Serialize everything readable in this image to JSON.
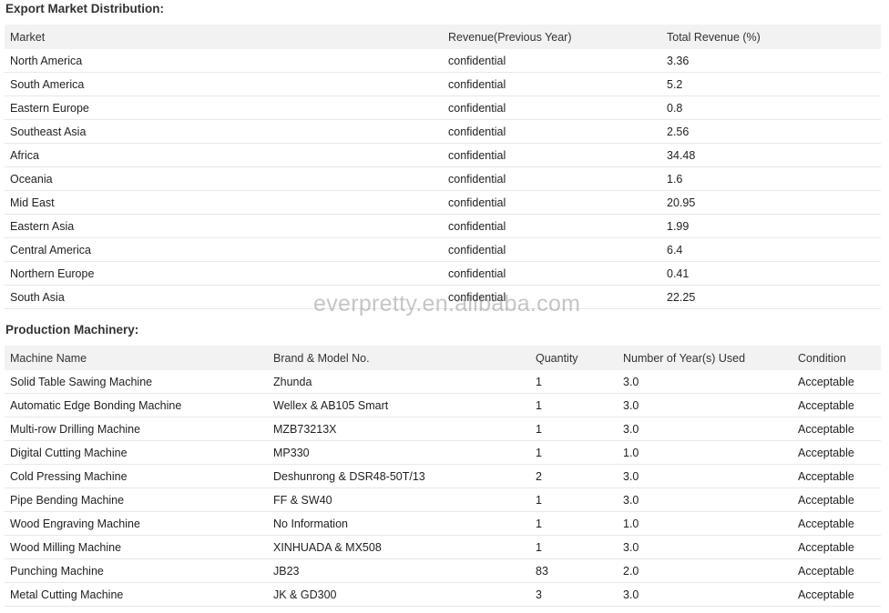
{
  "export_market": {
    "title": "Export Market Distribution:",
    "headers": [
      "Market",
      "Revenue(Previous Year)",
      "Total Revenue (%)"
    ],
    "rows": [
      [
        "North America",
        "confidential",
        "3.36"
      ],
      [
        "South America",
        "confidential",
        "5.2"
      ],
      [
        "Eastern Europe",
        "confidential",
        "0.8"
      ],
      [
        "Southeast Asia",
        "confidential",
        "2.56"
      ],
      [
        "Africa",
        "confidential",
        "34.48"
      ],
      [
        "Oceania",
        "confidential",
        "1.6"
      ],
      [
        "Mid East",
        "confidential",
        "20.95"
      ],
      [
        "Eastern Asia",
        "confidential",
        "1.99"
      ],
      [
        "Central America",
        "confidential",
        "6.4"
      ],
      [
        "Northern Europe",
        "confidential",
        "0.41"
      ],
      [
        "South Asia",
        "confidential",
        "22.25"
      ]
    ]
  },
  "production_machinery": {
    "title": "Production Machinery:",
    "headers": [
      "Machine Name",
      "Brand & Model No.",
      "Quantity",
      "Number of Year(s) Used",
      "Condition"
    ],
    "rows": [
      [
        "Solid Table Sawing Machine",
        "Zhunda",
        "1",
        "3.0",
        "Acceptable"
      ],
      [
        "Automatic Edge Bonding Machine",
        "Wellex & AB105 Smart",
        "1",
        "3.0",
        "Acceptable"
      ],
      [
        "Multi-row Drilling Machine",
        "MZB73213X",
        "1",
        "3.0",
        "Acceptable"
      ],
      [
        "Digital Cutting Machine",
        "MP330",
        "1",
        "1.0",
        "Acceptable"
      ],
      [
        "Cold Pressing Machine",
        "Deshunrong & DSR48-50T/13",
        "2",
        "3.0",
        "Acceptable"
      ],
      [
        "Pipe Bending Machine",
        "FF & SW40",
        "1",
        "3.0",
        "Acceptable"
      ],
      [
        "Wood Engraving Machine",
        "No Information",
        "1",
        "1.0",
        "Acceptable"
      ],
      [
        "Wood Milling Machine",
        "XINHUADA & MX508",
        "1",
        "3.0",
        "Acceptable"
      ],
      [
        "Punching Machine",
        "JB23",
        "83",
        "2.0",
        "Acceptable"
      ],
      [
        "Metal Cutting Machine",
        "JK & GD300",
        "3",
        "3.0",
        "Acceptable"
      ]
    ]
  },
  "watermark": "everpretty.en.alibaba.com"
}
